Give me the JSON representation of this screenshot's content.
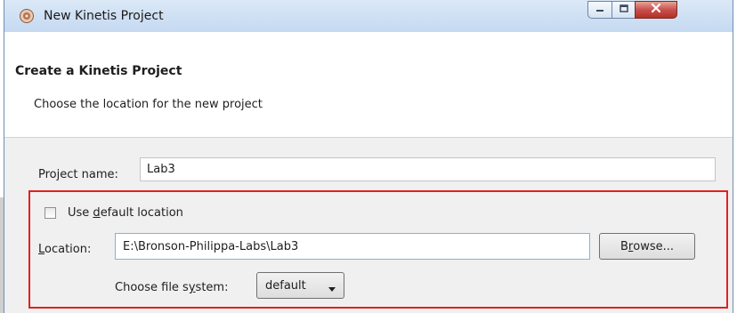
{
  "window": {
    "title": "New Kinetis Project",
    "icon": "kinetis-app-icon",
    "controls": [
      "minimize-icon",
      "maximize-icon",
      "close-icon"
    ]
  },
  "header": {
    "title": "Create a Kinetis Project",
    "description": "Choose the location for the new project"
  },
  "form": {
    "project_name_label": "Project name:",
    "project_name_value": "Lab3",
    "use_default": {
      "label_pre": "Use ",
      "label_mnemonic": "d",
      "label_post": "efault location",
      "checked": false
    },
    "location": {
      "label_mnemonic": "L",
      "label_rest": "ocation:",
      "value": "E:\\Bronson-Philippa-Labs\\Lab3"
    },
    "browse": {
      "label_pre": "B",
      "label_mnemonic": "r",
      "label_post": "owse..."
    },
    "file_system": {
      "label_pre": "Choose file s",
      "label_mnemonic": "y",
      "label_post": "stem:",
      "selected": "default"
    }
  },
  "colors": {
    "highlight_box": "#e02020",
    "titlebar": "#c5d9f1",
    "close_button": "#c75050"
  }
}
